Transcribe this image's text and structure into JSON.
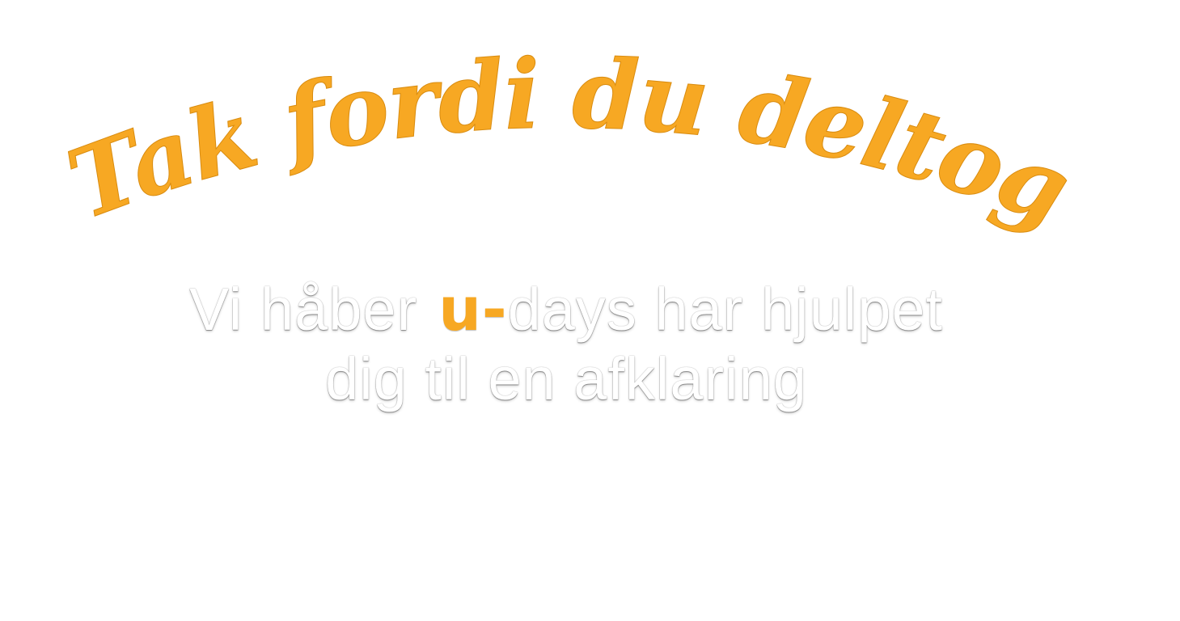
{
  "headline": {
    "text": "Tak fordi du deltog",
    "color": "#f7a823"
  },
  "message": {
    "line1_before": "Vi håber",
    "brand": "u-",
    "line1_after": "days har hjulpet",
    "line2": "dig til en afklaring",
    "text_color": "#ffffff"
  }
}
